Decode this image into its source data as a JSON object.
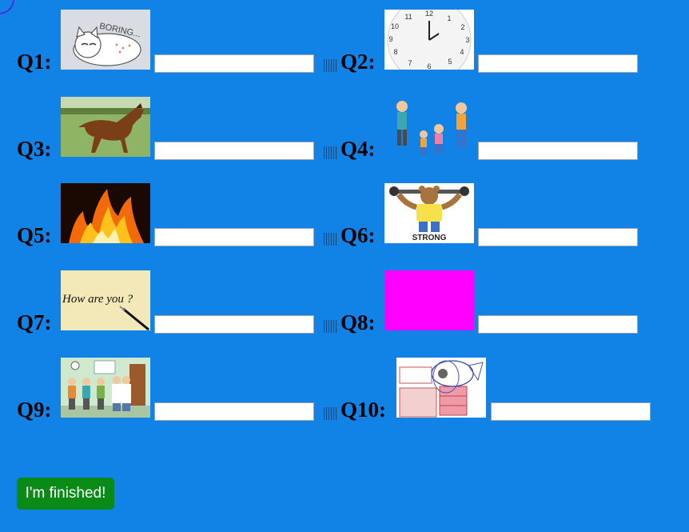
{
  "questions": [
    {
      "label": "Q1:",
      "image": "boring-cat-icon",
      "answer": ""
    },
    {
      "label": "Q2:",
      "image": "clock-icon",
      "answer": ""
    },
    {
      "label": "Q3:",
      "image": "horse-photo",
      "answer": ""
    },
    {
      "label": "Q4:",
      "image": "family-walking-icon",
      "answer": ""
    },
    {
      "label": "Q5:",
      "image": "fire-photo",
      "answer": ""
    },
    {
      "label": "Q6:",
      "image": "strong-bear-icon",
      "answer": ""
    },
    {
      "label": "Q7:",
      "image": "how-are-you-note",
      "answer": ""
    },
    {
      "label": "Q8:",
      "image": "magenta-placeholder",
      "answer": ""
    },
    {
      "label": "Q9:",
      "image": "waiting-room-icon",
      "answer": ""
    },
    {
      "label": "Q10:",
      "image": "messy-room-sketch",
      "answer": ""
    }
  ],
  "image_text": {
    "boring": "BORING...",
    "strong": "STRONG",
    "note": "How are you ?"
  },
  "finish_button": {
    "label": "I'm finished!"
  },
  "colors": {
    "background": "#1283e6",
    "button": "#0a8a16",
    "magenta": "#ff00ff"
  }
}
